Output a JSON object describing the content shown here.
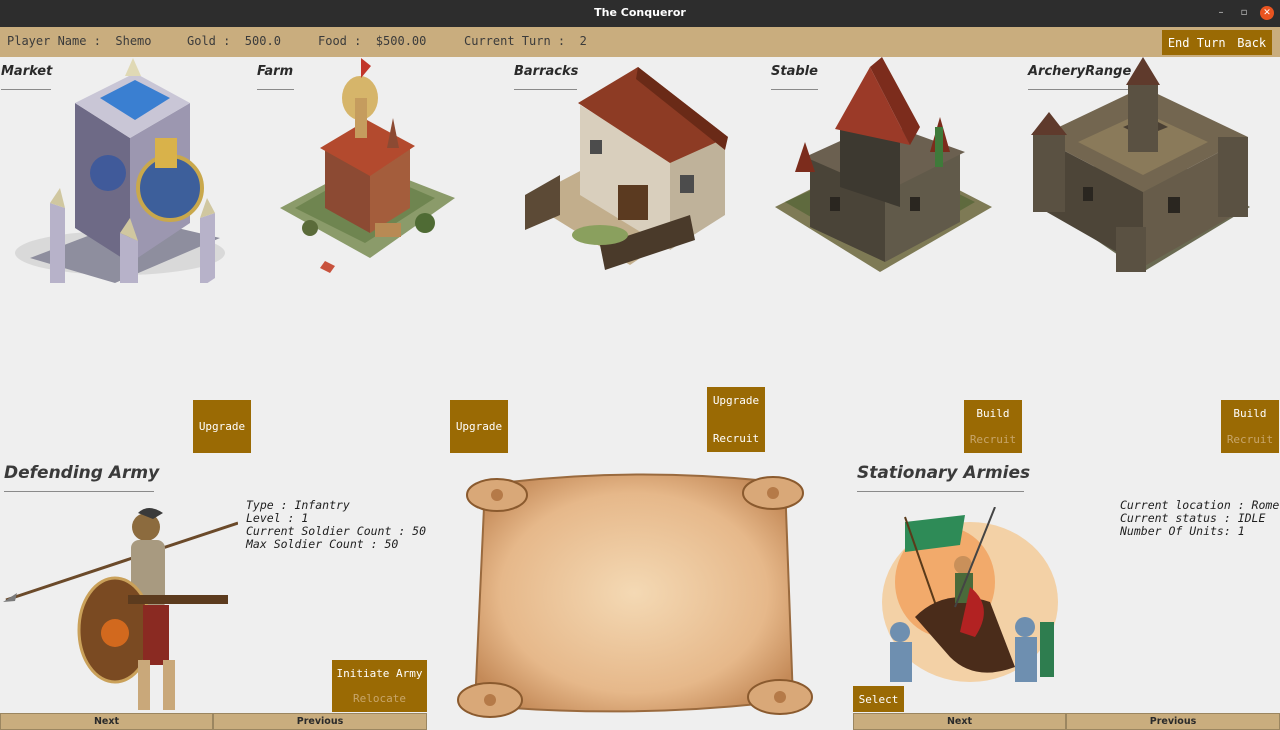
{
  "window": {
    "title": "The Conqueror",
    "controls": {
      "minimize": "–",
      "maximize": "▫",
      "close": "✕"
    }
  },
  "info_bar": {
    "player_name": "Player Name :  Shemo",
    "gold": "Gold :  500.0",
    "food": "Food :  $500.00",
    "current_turn": "Current Turn :  2",
    "end_turn": "End Turn",
    "back": "Back"
  },
  "buildings": [
    {
      "name": "Market",
      "buttons": [
        "Upgrade"
      ]
    },
    {
      "name": "Farm",
      "buttons": [
        "Upgrade"
      ]
    },
    {
      "name": "Barracks",
      "buttons": [
        "Upgrade",
        "Recruit"
      ]
    },
    {
      "name": "Stable",
      "buttons": [
        "Build",
        "Recruit"
      ]
    },
    {
      "name": "ArcheryRange",
      "buttons": [
        "Build",
        "Recruit"
      ]
    }
  ],
  "defending_army": {
    "title": "Defending Army",
    "type": "Type : Infantry",
    "level": "Level : 1",
    "current_count": "Current Soldier Count : 50",
    "max_count": "Max Soldier Count : 50",
    "initiate_army": "Initiate Army",
    "relocate": "Relocate",
    "next": "Next",
    "previous": "Previous"
  },
  "stationary_armies": {
    "title": "Stationary Armies",
    "location": "Current location : Rome",
    "status": "Current status : IDLE",
    "units": "Number Of Units: 1",
    "select": "Select",
    "next": "Next",
    "previous": "Previous"
  },
  "colors": {
    "accent": "#9a6a04",
    "bar": "#c9ad7e",
    "titlebar": "#2d2d2d",
    "disabled_text": "#c8a66b"
  }
}
